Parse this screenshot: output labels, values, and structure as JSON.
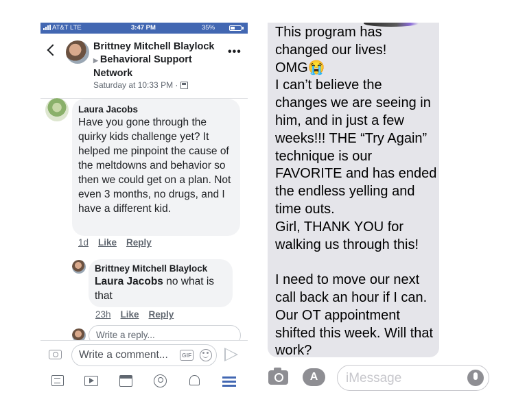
{
  "facebook": {
    "status_bar": {
      "carrier": "AT&T  LTE",
      "time": "3:47 PM",
      "battery": "35%"
    },
    "post": {
      "author": "Brittney Mitchell Blaylock",
      "arrow": "▶",
      "target": "Behavioral Support Network",
      "timestamp": "Saturday at 10:33 PM ·"
    },
    "comments": [
      {
        "author": "Laura Jacobs",
        "text": "Have you gone through the quirky kids challenge yet? It helped me pinpoint the cause of the meltdowns and behavior so then we could get on a plan. Not even 3 months, no drugs, and I have a different kid.",
        "age": "1d",
        "like": "Like",
        "reply": "Reply"
      },
      {
        "author": "Brittney Mitchell Blaylock",
        "mention": "Laura Jacobs",
        "text": " no what is that",
        "age": "23h",
        "like": "Like",
        "reply": "Reply"
      }
    ],
    "reply_placeholder": "Write a reply...",
    "comment_placeholder": "Write a comment...",
    "gif_label": "GIF",
    "tabs": [
      "news-feed",
      "watch",
      "marketplace",
      "profile",
      "notifications",
      "menu"
    ],
    "brand_color": "#4267b2"
  },
  "imessage": {
    "message": "This program has changed our lives!\nOMG😭\nI can’t believe the changes we are seeing in him, and in just a few weeks!!! THE “Try Again” technique is our FAVORITE and has ended the endless yelling and time outs.\nGirl, THANK YOU for walking us through this!\n\nI need to move our next call back an hour if I can. Our OT appointment shifted this week. Will that work?",
    "input_placeholder": "iMessage",
    "appstore_glyph": "A"
  }
}
